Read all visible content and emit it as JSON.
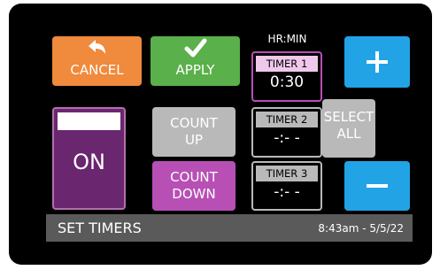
{
  "buttons": {
    "cancel": "CANCEL",
    "apply": "APPLY",
    "on": "ON",
    "count_up_line1": "COUNT",
    "count_up_line2": "UP",
    "count_down_line1": "COUNT",
    "count_down_line2": "DOWN",
    "select_all_line1": "SELECT",
    "select_all_line2": "ALL",
    "plus": "+",
    "minus": "–"
  },
  "timers_header": "HR:MIN",
  "timers": [
    {
      "label": "TIMER 1",
      "value": "0:30"
    },
    {
      "label": "TIMER 2",
      "value": "-:- -"
    },
    {
      "label": "TIMER 3",
      "value": "-:- -"
    }
  ],
  "status_bar": {
    "title": "SET TIMERS",
    "datetime": "8:43am - 5/5/22"
  },
  "colors": {
    "cancel": "#f08a3c",
    "apply": "#5ab04a",
    "plus_minus": "#21a3e6",
    "count_down": "#b84fb4",
    "on_button": "#6b2670",
    "inactive": "#b9b9b9"
  },
  "icons": {
    "cancel": "undo-arrow-icon",
    "apply": "checkmark-icon"
  }
}
